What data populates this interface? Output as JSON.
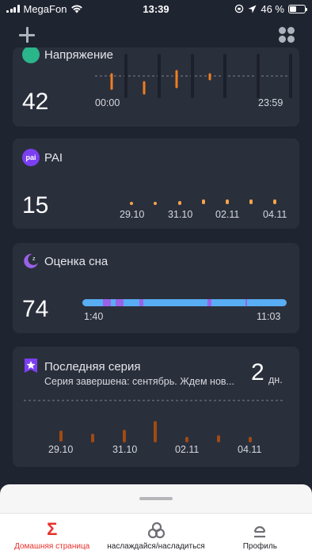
{
  "status_bar": {
    "carrier": "MegaFon",
    "time": "13:39",
    "battery": "46 %",
    "battery_level": 0.46
  },
  "colors": {
    "stress": "#f07d1f",
    "pai": "#f5a54a",
    "sleep_bar": "#59adf2",
    "sleep_deep": "#9a62e8",
    "streak": "#a04b12",
    "accent": "#e8302c"
  },
  "cards": {
    "stress": {
      "title": "Напряжение",
      "value": "42",
      "start_time": "00:00",
      "end_time": "23:59",
      "icon": "stress-icon"
    },
    "pai": {
      "title": "PAI",
      "icon_text": "pai",
      "value": "15",
      "dates": [
        "29.10",
        "31.10",
        "02.11",
        "04.11"
      ]
    },
    "sleep": {
      "title": "Оценка сна",
      "value": "74",
      "start": "1:40",
      "end": "11:03",
      "icon": "moon-icon"
    },
    "streak": {
      "title": "Последняя серия",
      "subtitle": "Серия завершена: сентябрь. Ждем нов...",
      "value": "2",
      "unit": "дн.",
      "icon": "star-badge-icon",
      "dates": [
        "29.10",
        "31.10",
        "02.11",
        "04.11"
      ]
    }
  },
  "tabs": [
    {
      "label": "Домашняя страница",
      "icon": "sigma-icon",
      "active": true
    },
    {
      "label": "наслаждайся/насладиться",
      "icon": "rings-icon",
      "active": false
    },
    {
      "label": "Профиль",
      "icon": "profile-icon",
      "active": false
    }
  ]
}
